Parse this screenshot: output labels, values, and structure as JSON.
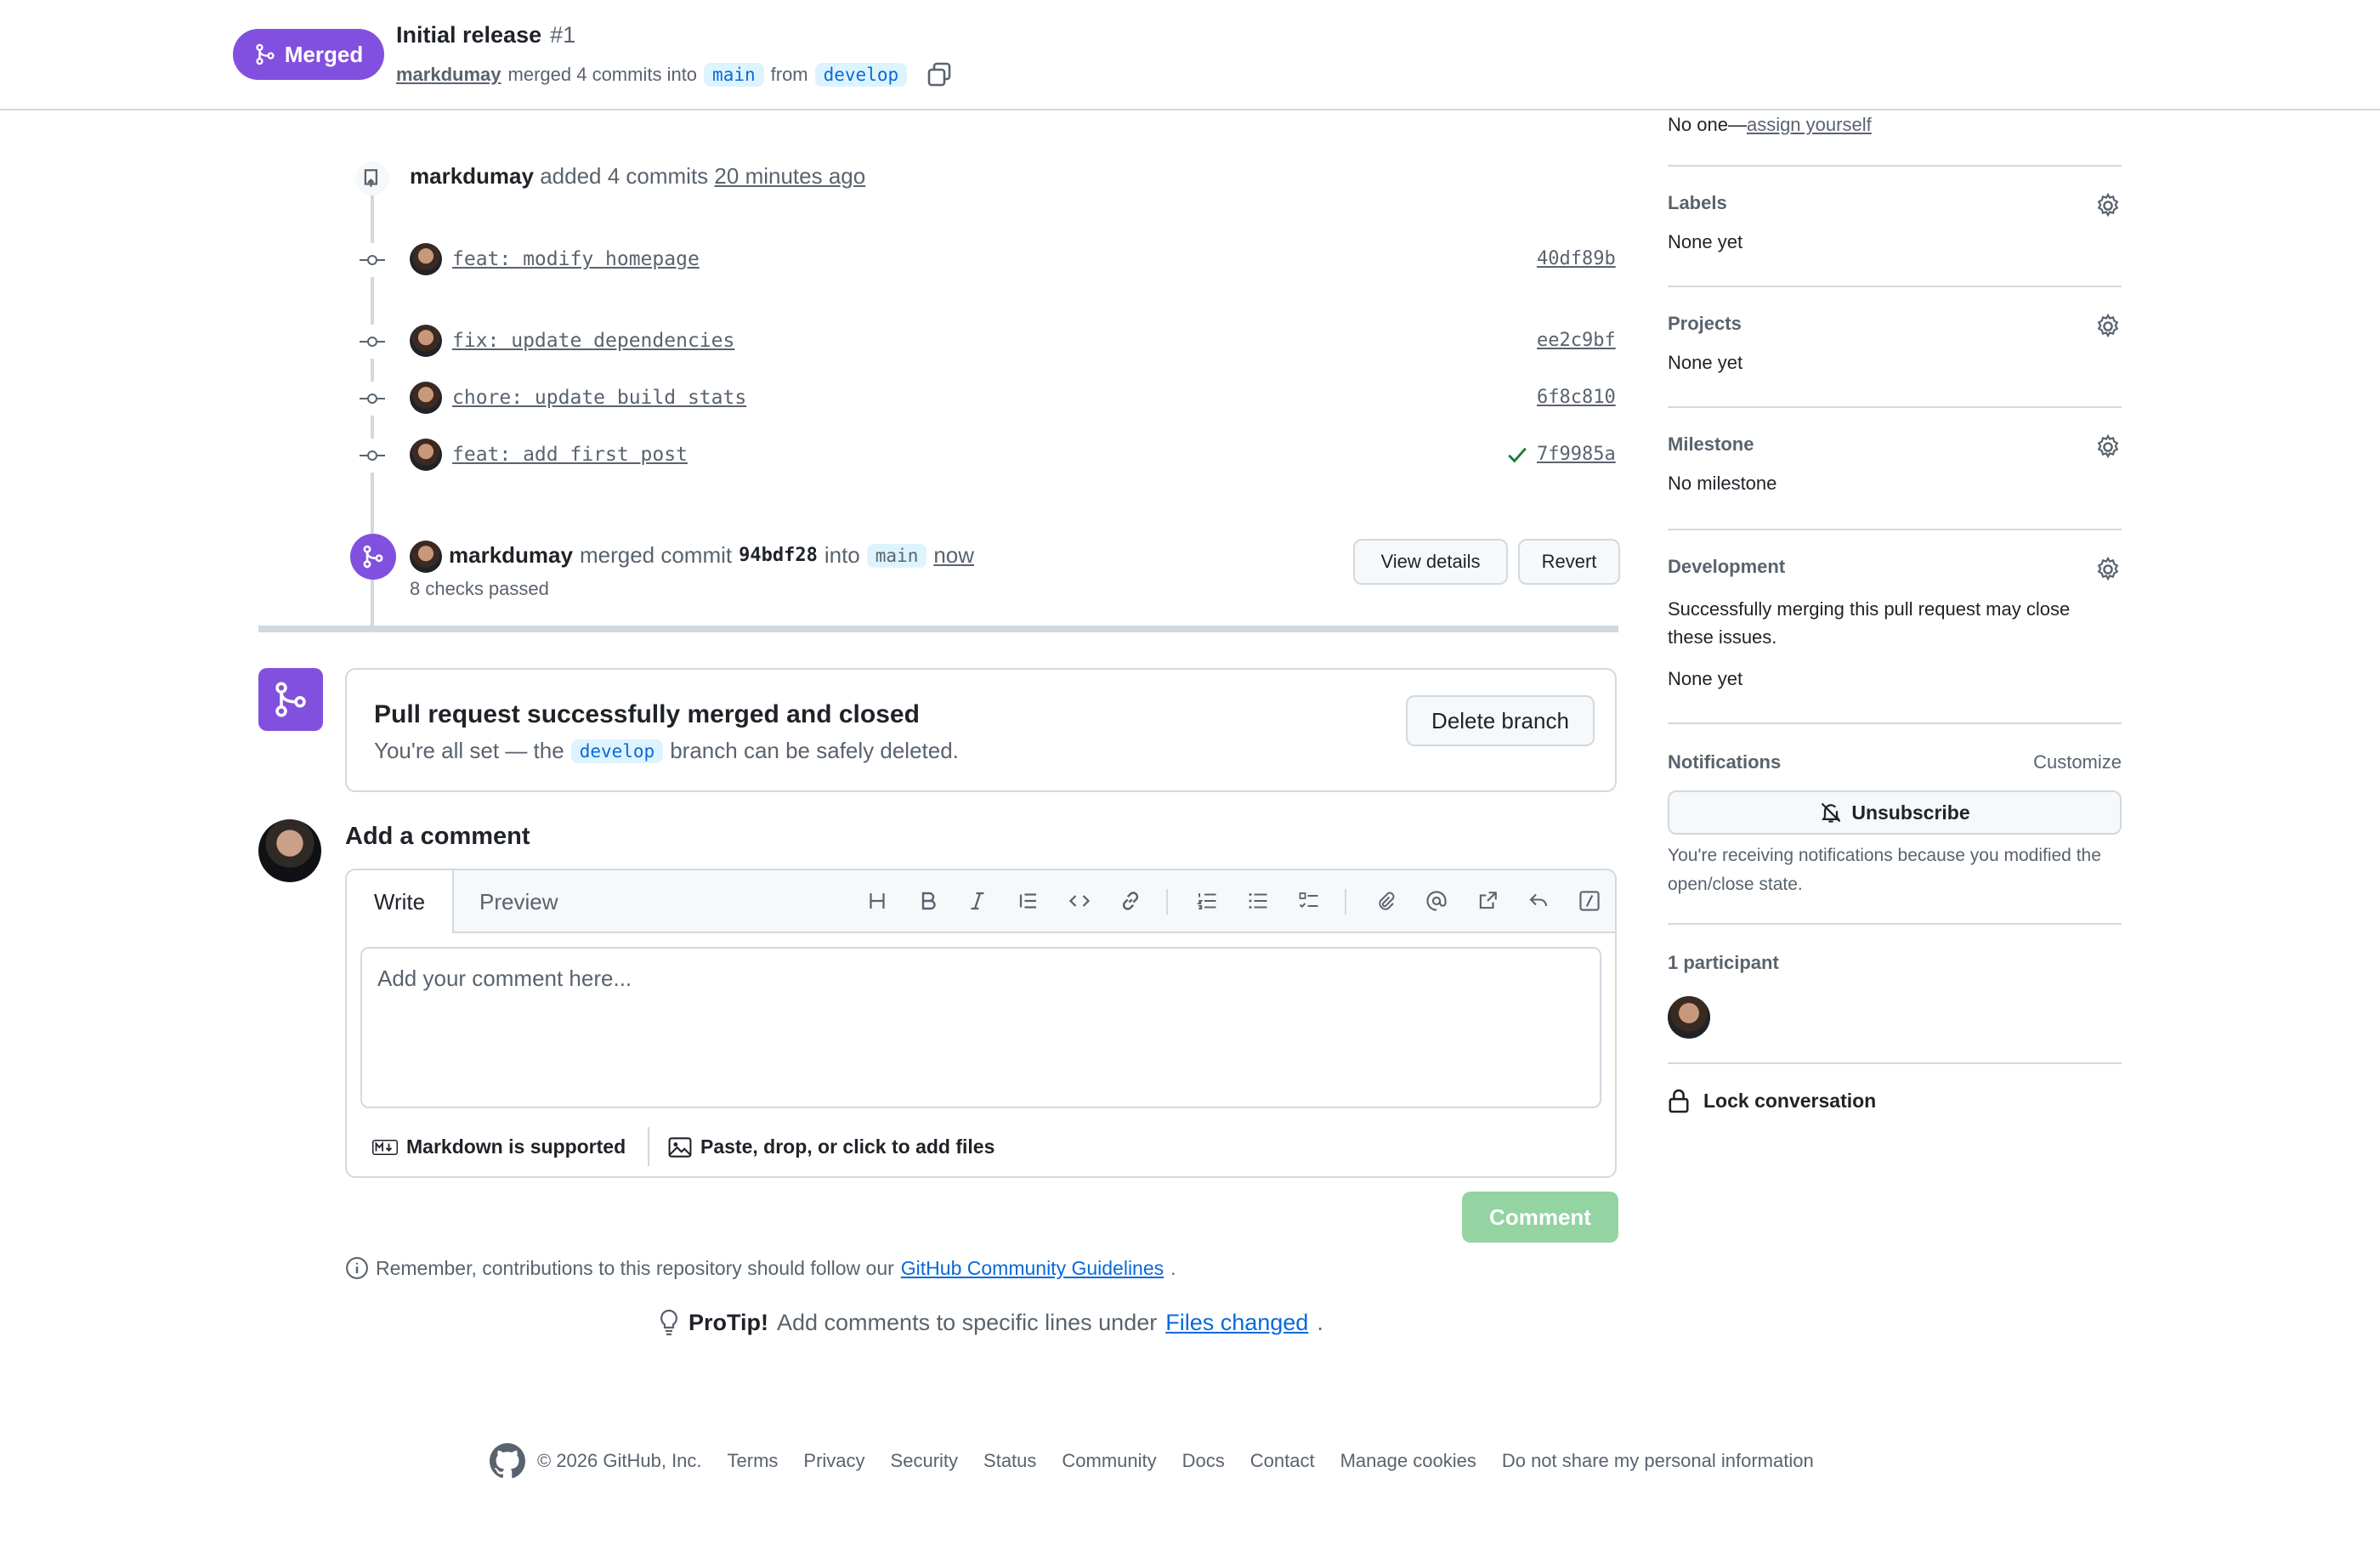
{
  "header": {
    "status_badge": "Merged",
    "title": "Initial release",
    "number": "#1",
    "author": "markdumay",
    "merged_text": "merged 4 commits into",
    "base_branch": "main",
    "from_text": "from",
    "head_branch": "develop"
  },
  "timeline": {
    "added_event": {
      "author": "markdumay",
      "text": "added 4 commits",
      "time": "20 minutes ago"
    },
    "commits": [
      {
        "message": "feat: modify homepage",
        "sha": "40df89b"
      },
      {
        "message": "fix: update dependencies",
        "sha": "ee2c9bf"
      },
      {
        "message": "chore: update build stats",
        "sha": "6f8c810"
      },
      {
        "message": "feat: add first post",
        "sha": "7f9985a"
      }
    ],
    "merge_event": {
      "author": "markdumay",
      "text": "merged commit",
      "commit": "94bdf28",
      "into": "into",
      "branch": "main",
      "time": "now",
      "checks": "8 checks passed",
      "view_details": "View details",
      "revert": "Revert"
    }
  },
  "merged_box": {
    "title": "Pull request successfully merged and closed",
    "sub_before": "You're all set — the",
    "branch": "develop",
    "sub_after": "branch can be safely deleted.",
    "delete_button": "Delete branch"
  },
  "comment": {
    "heading": "Add a comment",
    "tab_write": "Write",
    "tab_preview": "Preview",
    "placeholder": "Add your comment here...",
    "markdown_note": "Markdown is supported",
    "files_note": "Paste, drop, or click to add files",
    "submit": "Comment",
    "remember_text": "Remember, contributions to this repository should follow our",
    "guidelines_link": "GitHub Community Guidelines",
    "protip_label": "ProTip!",
    "protip_text": "Add comments to specific lines under",
    "protip_link": "Files changed"
  },
  "sidebar": {
    "assignees_value": "No one—",
    "assign_yourself": "assign yourself",
    "labels": {
      "label": "Labels",
      "value": "None yet"
    },
    "projects": {
      "label": "Projects",
      "value": "None yet"
    },
    "milestone": {
      "label": "Milestone",
      "value": "No milestone"
    },
    "development": {
      "label": "Development",
      "desc": "Successfully merging this pull request may close these issues.",
      "value": "None yet"
    },
    "notifications": {
      "label": "Notifications",
      "customize": "Customize",
      "unsubscribe": "Unsubscribe",
      "reason": "You're receiving notifications because you modified the open/close state."
    },
    "participants": {
      "label": "1 participant"
    },
    "lock": "Lock conversation"
  },
  "footer": {
    "copyright": "© 2026 GitHub, Inc.",
    "links": [
      "Terms",
      "Privacy",
      "Security",
      "Status",
      "Community",
      "Docs",
      "Contact",
      "Manage cookies",
      "Do not share my personal information"
    ]
  },
  "colors": {
    "merged_purple": "#8250df",
    "link_blue": "#0969da",
    "comment_green_disabled": "#94d3a2",
    "check_green": "#1a7f37"
  }
}
